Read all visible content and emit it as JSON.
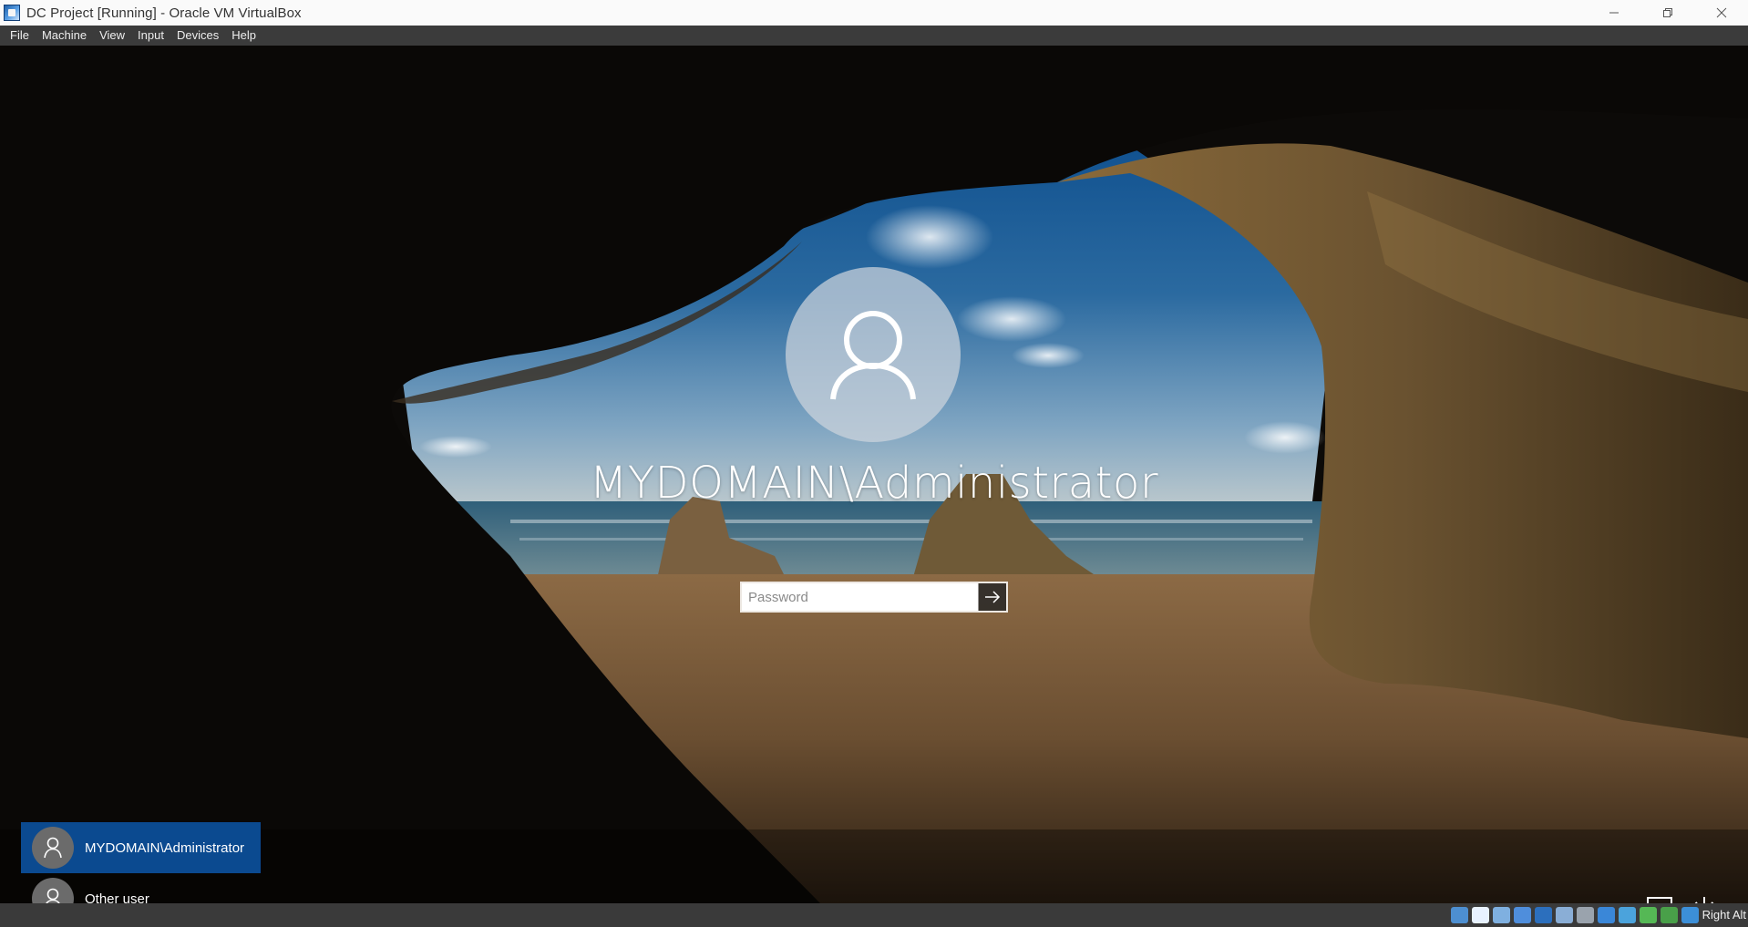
{
  "window": {
    "title": "DC Project [Running] - Oracle VM VirtualBox",
    "minimize_glyph": "—",
    "maximize_glyph": "❐",
    "close_glyph": "✕"
  },
  "menu": {
    "items": [
      {
        "label": "File"
      },
      {
        "label": "Machine"
      },
      {
        "label": "View"
      },
      {
        "label": "Input"
      },
      {
        "label": "Devices"
      },
      {
        "label": "Help"
      }
    ]
  },
  "login": {
    "username": "MYDOMAIN\\Administrator",
    "password_placeholder": "Password",
    "password_value": "",
    "submit_icon": "arrow-right-icon"
  },
  "user_list": [
    {
      "name": "MYDOMAIN\\Administrator",
      "selected": true,
      "icon": "user-icon"
    },
    {
      "name": "Other user",
      "selected": false,
      "icon": "user-icon"
    }
  ],
  "corner_icons": [
    "network-warning-icon",
    "power-icon"
  ],
  "statusbar": {
    "host_key": "Right Alt",
    "icons": [
      "hard-disk-icon",
      "optical-drive-icon",
      "audio-icon",
      "network-icon",
      "usb-icon",
      "shared-folders-icon",
      "display-icon",
      "recording-icon",
      "mouse-integration-icon",
      "keyboard-icon",
      "cpu-icon",
      "download-icon"
    ],
    "icon_colors": [
      "#4d8fd1",
      "#e8f2ff",
      "#7fb0e0",
      "#4f8edc",
      "#2c6fbd",
      "#8aaed6",
      "#9aa3ad",
      "#3a87d8",
      "#4ba3dc",
      "#55b855",
      "#49a049",
      "#3c8fd8"
    ]
  }
}
